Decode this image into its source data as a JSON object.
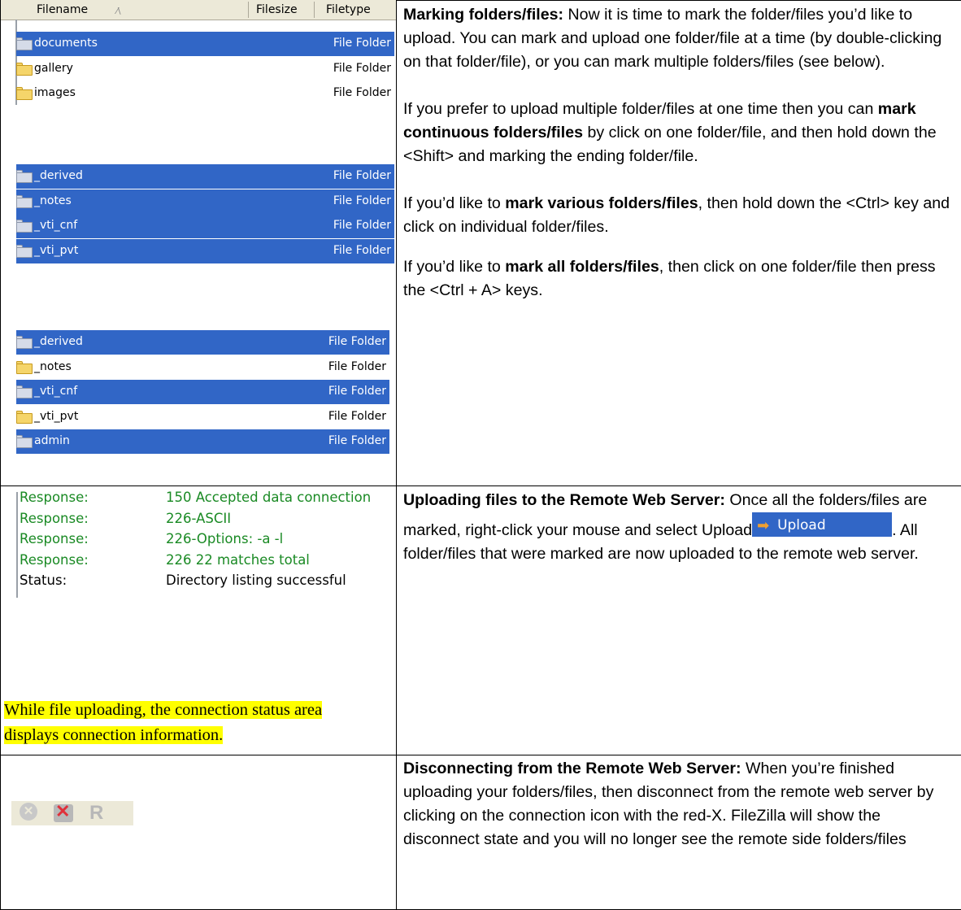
{
  "section1": {
    "header": {
      "filename": "Filename",
      "sort_indicator": "⁄\\",
      "filesize": "Filesize",
      "filetype": "Filetype"
    },
    "list1": [
      {
        "name": "documents",
        "type": "File Folder",
        "selected": true
      },
      {
        "name": "gallery",
        "type": "File Folder",
        "selected": false
      },
      {
        "name": "images",
        "type": "File Folder",
        "selected": false
      }
    ],
    "list2": [
      {
        "name": "_derived",
        "type": "File Folder",
        "selected": true
      },
      {
        "name": "_notes",
        "type": "File Folder",
        "selected": true
      },
      {
        "name": "_vti_cnf",
        "type": "File Folder",
        "selected": true
      },
      {
        "name": "_vti_pvt",
        "type": "File Folder",
        "selected": true
      }
    ],
    "list3": [
      {
        "name": "_derived",
        "type": "File Folder",
        "selected": true
      },
      {
        "name": "_notes",
        "type": "File Folder",
        "selected": false
      },
      {
        "name": "_vti_cnf",
        "type": "File Folder",
        "selected": true
      },
      {
        "name": "_vti_pvt",
        "type": "File Folder",
        "selected": false
      },
      {
        "name": "admin",
        "type": "File Folder",
        "selected": true
      }
    ],
    "p1_bold": "Marking folders/files:",
    "p1_rest": " Now it is time to mark the folder/files you’d like to upload.  You can mark and upload one folder/file at a time (by double-clicking on that folder/file), or you can mark multiple folders/files (see below).",
    "p2_a": "If you prefer to upload multiple folder/files at one time then you can ",
    "p2_bold": "mark continuous folders/files",
    "p2_b": " by click on one folder/file, and then hold down the <Shift> and marking the ending folder/file.",
    "p3_a": "If you’d like to ",
    "p3_bold": "mark various folders/files",
    "p3_b": ", then hold down the <Ctrl> key and click on individual folder/files.",
    "p4_a": "If you’d like to ",
    "p4_bold": "mark all folders/files",
    "p4_b": ", then click on one folder/file then press the <Ctrl + A> keys."
  },
  "section2": {
    "log": [
      {
        "label": "Response:",
        "value": "150 Accepted data connection",
        "green": true
      },
      {
        "label": "Response:",
        "value": "226-ASCII",
        "green": true
      },
      {
        "label": "Response:",
        "value": "226-Options: -a -l",
        "green": true
      },
      {
        "label": "Response:",
        "value": "226 22 matches total",
        "green": true
      },
      {
        "label": "Status:",
        "value": "Directory listing successful",
        "green": false
      }
    ],
    "note": "While file uploading, the connection status area displays connection information.",
    "p_bold": "Uploading files to the Remote Web Server:",
    "p_a": "  Once all the folders/files are marked, right-click your mouse and select Upload",
    "upload_label": "Upload",
    "p_b": ".  All folder/files that were marked are now uploaded to the remote web server."
  },
  "section3": {
    "toolbar_icons": [
      "cancel-icon",
      "disconnect-icon",
      "reconnect-icon"
    ],
    "reconnect_letter": "R",
    "p_bold": "Disconnecting from the Remote Web Server:",
    "p_rest": "  When you’re finished uploading your folders/files, then disconnect from the remote web server by clicking on the connection icon with the red-X.  FileZilla will show the disconnect state and you will no longer see the remote side folders/files"
  }
}
